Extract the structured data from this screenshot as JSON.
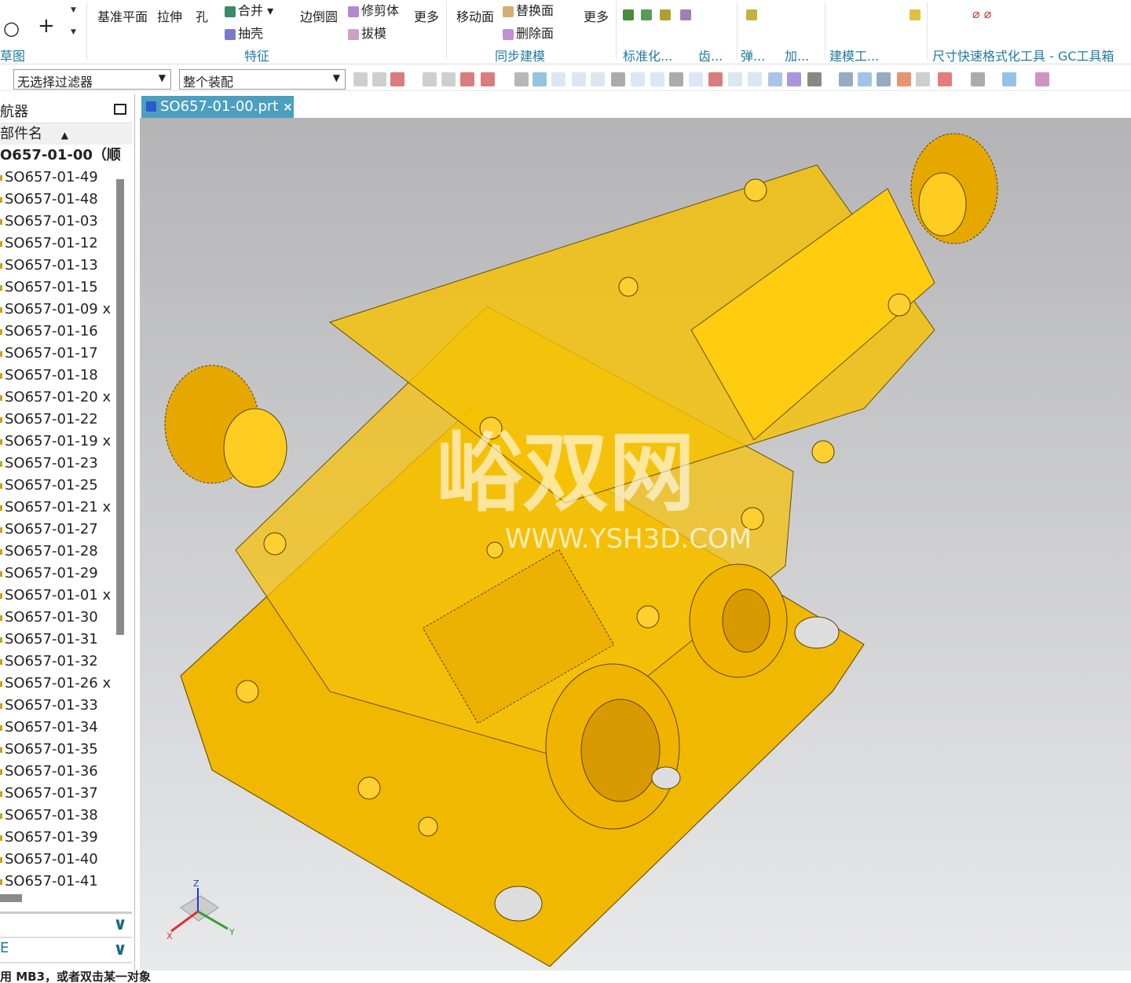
{
  "ribbon": {
    "buttons": [
      "基准平面",
      "拉伸",
      "孔",
      "合并",
      "抽壳",
      "边倒圆",
      "修剪体",
      "拔模",
      "更多",
      "移动面",
      "替换面",
      "删除面",
      "更多"
    ],
    "groups": [
      "草图",
      "特征",
      "同步建模",
      "标准化...",
      "齿...",
      "弹...",
      "加...",
      "建模工...",
      "尺寸快速格式化工具 - GC工具箱"
    ]
  },
  "toolbar": {
    "filter": "无选择过滤器",
    "scope": "整个装配"
  },
  "navigator": {
    "title": "航器",
    "column": "部件名",
    "root": "O657-01-00（顺",
    "items": [
      "SO657-01-49",
      "SO657-01-48",
      "SO657-01-03",
      "SO657-01-12",
      "SO657-01-13",
      "SO657-01-15",
      "SO657-01-09 x",
      "SO657-01-16",
      "SO657-01-17",
      "SO657-01-18",
      "SO657-01-20 x",
      "SO657-01-22",
      "SO657-01-19 x",
      "SO657-01-23",
      "SO657-01-25",
      "SO657-01-21 x",
      "SO657-01-27",
      "SO657-01-28",
      "SO657-01-29",
      "SO657-01-01 x",
      "SO657-01-30",
      "SO657-01-31",
      "SO657-01-32",
      "SO657-01-26 x",
      "SO657-01-33",
      "SO657-01-34",
      "SO657-01-35",
      "SO657-01-36",
      "SO657-01-37",
      "SO657-01-38",
      "SO657-01-39",
      "SO657-01-40",
      "SO657-01-41"
    ],
    "section2": "",
    "section3": "E"
  },
  "tab": {
    "label": "SO657-01-00.prt",
    "close": "×"
  },
  "viewport": {
    "watermark_logo": "峪双网",
    "watermark_url": "WWW.YSH3D.COM",
    "axes": [
      "X",
      "Y",
      "Z"
    ]
  },
  "status": {
    "text": "用 MB3，或者双击某一对象"
  }
}
